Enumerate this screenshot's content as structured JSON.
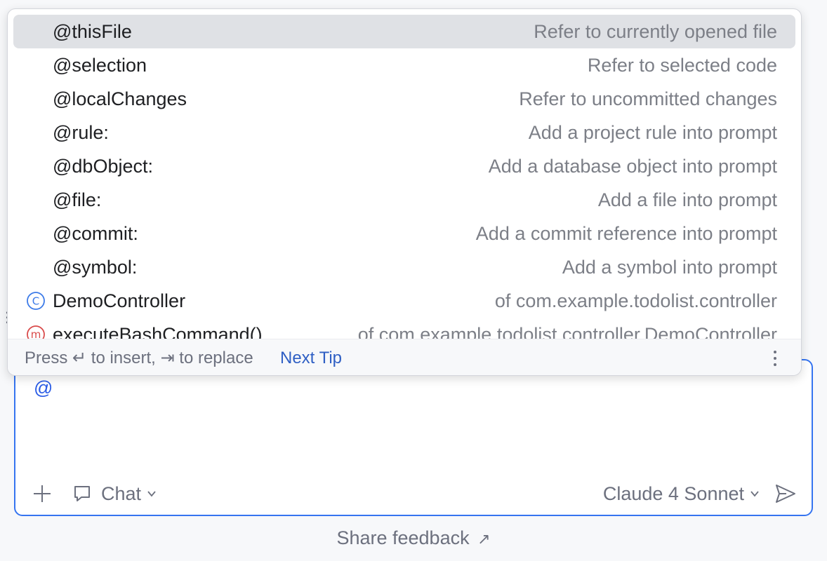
{
  "popup": {
    "items": [
      {
        "name": "@thisFile",
        "desc": "Refer to currently opened file",
        "selected": true
      },
      {
        "name": "@selection",
        "desc": "Refer to selected code"
      },
      {
        "name": "@localChanges",
        "desc": "Refer to uncommitted changes"
      },
      {
        "name": "@rule:",
        "desc": "Add a project rule into prompt"
      },
      {
        "name": "@dbObject:",
        "desc": "Add a database object into prompt"
      },
      {
        "name": "@file:",
        "desc": "Add a file into prompt"
      },
      {
        "name": "@commit:",
        "desc": "Add a commit reference into prompt"
      },
      {
        "name": "@symbol:",
        "desc": "Add a symbol into prompt"
      },
      {
        "name": "DemoController",
        "desc": "of com.example.todolist.controller",
        "icon": "class-icon",
        "icon_letter": "C"
      },
      {
        "name": "executeBashCommand()",
        "desc": "of com.example.todolist.controller.DemoController",
        "icon": "method-icon",
        "icon_letter": "m"
      }
    ],
    "status_text": "Press ↵ to insert, ⇥ to replace",
    "next_tip": "Next Tip"
  },
  "input": {
    "value": "@"
  },
  "toolbar": {
    "mode_label": "Chat",
    "model_label": "Claude 4 Sonnet"
  },
  "footer": {
    "feedback_label": "Share feedback",
    "feedback_arrow": "↗"
  },
  "colors": {
    "accent": "#3574f0",
    "link": "#2f5fc4",
    "selection": "#dfe1e5",
    "class_icon": "#3d7be8",
    "method_icon": "#d94a4a"
  }
}
